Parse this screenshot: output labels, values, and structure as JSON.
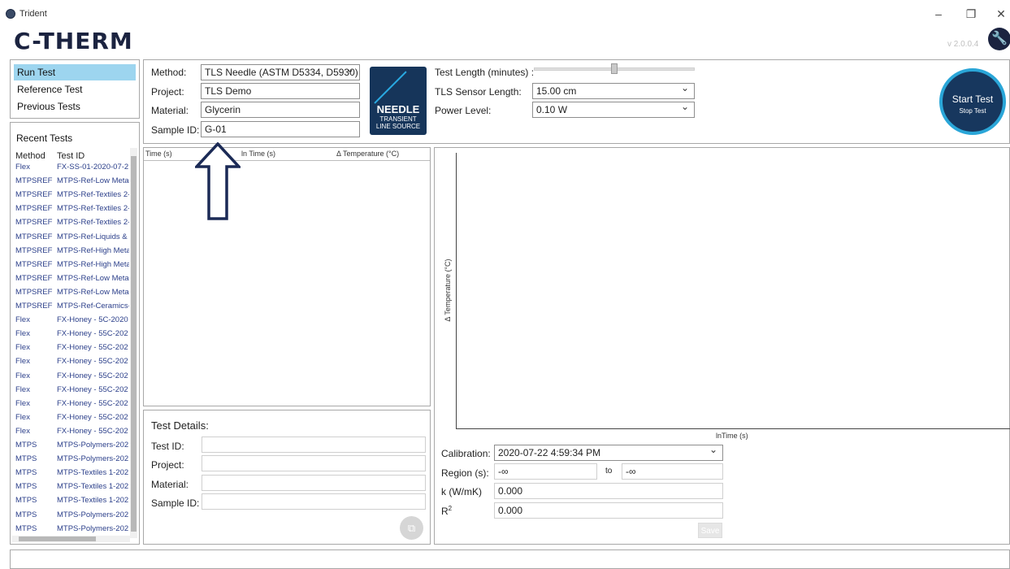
{
  "window": {
    "title": "Trident",
    "minimize": "–",
    "restore": "❐",
    "close": "✕"
  },
  "brand": {
    "logo": "C-THERM",
    "version": "v 2.0.0.4"
  },
  "nav": [
    {
      "label": "Run Test",
      "active": true
    },
    {
      "label": "Reference Test",
      "active": false
    },
    {
      "label": "Previous Tests",
      "active": false
    }
  ],
  "recent": {
    "title": "Recent Tests",
    "columns": [
      "Method",
      "Test ID"
    ],
    "rows": [
      [
        "Flex",
        "FX-SS-01-2020-07-2"
      ],
      [
        "MTPSREF",
        "MTPS-Ref-Low Meta"
      ],
      [
        "MTPSREF",
        "MTPS-Ref-Textiles 2-"
      ],
      [
        "MTPSREF",
        "MTPS-Ref-Textiles 2-"
      ],
      [
        "MTPSREF",
        "MTPS-Ref-Textiles 2-"
      ],
      [
        "MTPSREF",
        "MTPS-Ref-Liquids &"
      ],
      [
        "MTPSREF",
        "MTPS-Ref-High Meta"
      ],
      [
        "MTPSREF",
        "MTPS-Ref-High Meta"
      ],
      [
        "MTPSREF",
        "MTPS-Ref-Low Meta"
      ],
      [
        "MTPSREF",
        "MTPS-Ref-Low Meta"
      ],
      [
        "MTPSREF",
        "MTPS-Ref-Ceramics-"
      ],
      [
        "Flex",
        "FX-Honey - 5C-2020"
      ],
      [
        "Flex",
        "FX-Honey - 55C-202"
      ],
      [
        "Flex",
        "FX-Honey - 55C-202"
      ],
      [
        "Flex",
        "FX-Honey - 55C-202"
      ],
      [
        "Flex",
        "FX-Honey - 55C-202"
      ],
      [
        "Flex",
        "FX-Honey - 55C-202"
      ],
      [
        "Flex",
        "FX-Honey - 55C-202"
      ],
      [
        "Flex",
        "FX-Honey - 55C-202"
      ],
      [
        "Flex",
        "FX-Honey - 55C-202"
      ],
      [
        "MTPS",
        "MTPS-Polymers-202"
      ],
      [
        "MTPS",
        "MTPS-Polymers-202"
      ],
      [
        "MTPS",
        "MTPS-Textiles 1-202"
      ],
      [
        "MTPS",
        "MTPS-Textiles 1-202"
      ],
      [
        "MTPS",
        "MTPS-Textiles 1-202"
      ],
      [
        "MTPS",
        "MTPS-Polymers-202"
      ],
      [
        "MTPS",
        "MTPS-Polymers-202"
      ]
    ]
  },
  "setup": {
    "method_label": "Method:",
    "method_value": "TLS Needle (ASTM D5334, D5930)",
    "project_label": "Project:",
    "project_value": "TLS Demo",
    "material_label": "Material:",
    "material_value": "Glycerin",
    "sample_label": "Sample ID:",
    "sample_value": "G-01"
  },
  "needle_logo": {
    "line1": "NEEDLE",
    "line2": "TRANSIENT",
    "line3": "LINE SOURCE"
  },
  "params": {
    "length_label": "Test Length (minutes) :",
    "length_fraction": 0.5,
    "sensor_label": "TLS Sensor Length:",
    "sensor_value": "15.00 cm",
    "power_label": "Power Level:",
    "power_value": "0.10 W"
  },
  "start": {
    "label": "Start Test",
    "sub": "Stop Test"
  },
  "table": {
    "headers": [
      "Time (s)",
      "ln Time (s)",
      "Δ Temperature (°C)"
    ]
  },
  "details": {
    "title": "Test Details:",
    "test_id_label": "Test ID:",
    "project_label": "Project:",
    "material_label": "Material:",
    "sample_label": "Sample ID:"
  },
  "chart": {
    "ylabel": "Δ Temperature (°C)",
    "xlabel": "lnTime (s)"
  },
  "results": {
    "calibration_label": "Calibration:",
    "calibration_value": "2020-07-22 4:59:34 PM",
    "region_label": "Region (s):",
    "region_from": "-∞",
    "region_to_label": "to",
    "region_to": "-∞",
    "k_label": "k (W/mK)",
    "k_value": "0.000",
    "r2_label": "R",
    "r2_sup": "2",
    "r2_value": "0.000",
    "save_label": "Save"
  },
  "colors": {
    "accent": "#9dd5ef",
    "brand": "#1b2340",
    "arrow": "#1b2a56",
    "ring": "#2aa6d8"
  }
}
